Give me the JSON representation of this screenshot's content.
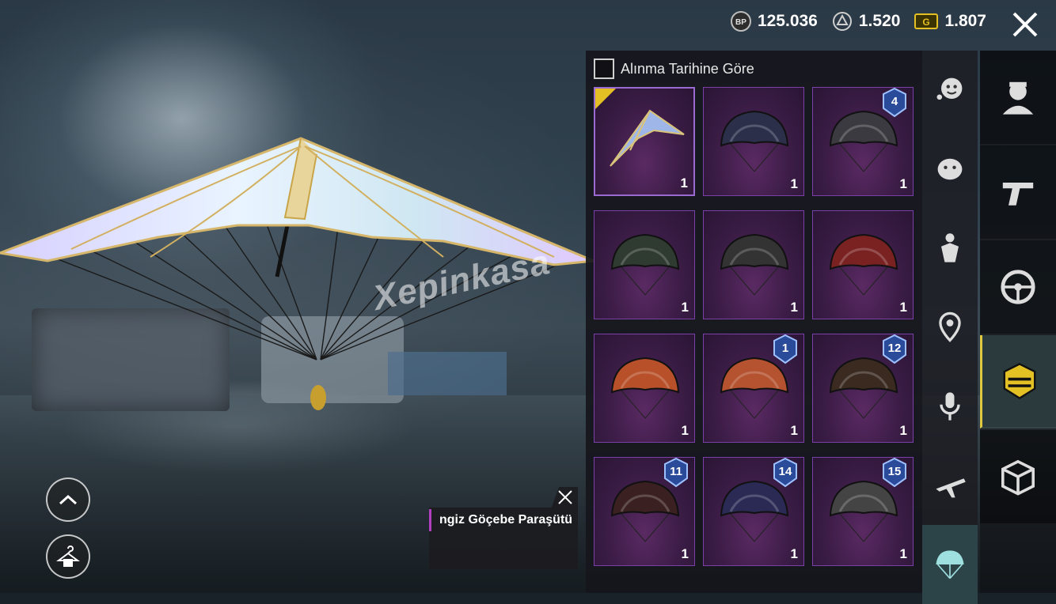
{
  "currency": {
    "bp": {
      "icon": "bp-coin-icon",
      "label": "BP",
      "value": "125.036"
    },
    "ag": {
      "icon": "ag-emblem-icon",
      "value": "1.520"
    },
    "uc": {
      "icon": "g-ticket-icon",
      "label": "G",
      "value": "1.807"
    }
  },
  "sort": {
    "label": "Alınma Tarihine Göre",
    "checked": false
  },
  "watermark": "Xepinkasa",
  "tooltip": {
    "name": "ngiz Göçebe Paraşütü"
  },
  "inventory": {
    "items": [
      {
        "icon": "glider-icon",
        "count": "1",
        "badge": "",
        "selected": true,
        "new": true
      },
      {
        "icon": "parachute-icon",
        "count": "1",
        "badge": ""
      },
      {
        "icon": "parachute-icon",
        "count": "1",
        "badge": "4"
      },
      {
        "icon": "parachute-icon",
        "count": "1",
        "badge": ""
      },
      {
        "icon": "parachute-icon",
        "count": "1",
        "badge": ""
      },
      {
        "icon": "parachute-icon",
        "count": "1",
        "badge": ""
      },
      {
        "icon": "parachute-icon",
        "count": "1",
        "badge": ""
      },
      {
        "icon": "parachute-icon",
        "count": "1",
        "badge": "1"
      },
      {
        "icon": "parachute-icon",
        "count": "1",
        "badge": "12"
      },
      {
        "icon": "parachute-icon",
        "count": "1",
        "badge": "11"
      },
      {
        "icon": "parachute-icon",
        "count": "1",
        "badge": "14"
      },
      {
        "icon": "parachute-icon",
        "count": "1",
        "badge": "15"
      }
    ]
  },
  "categories_sub": [
    {
      "icon": "emote-icon"
    },
    {
      "icon": "companion-icon"
    },
    {
      "icon": "pose-icon"
    },
    {
      "icon": "location-pin-icon"
    },
    {
      "icon": "microphone-icon"
    },
    {
      "icon": "airplane-icon"
    },
    {
      "icon": "parachute-icon",
      "active": true
    }
  ],
  "categories_main": [
    {
      "icon": "character-icon"
    },
    {
      "icon": "pistol-icon"
    },
    {
      "icon": "steering-wheel-icon"
    },
    {
      "icon": "season-shield-icon",
      "active": true
    },
    {
      "icon": "crate-icon"
    }
  ],
  "colors": {
    "tile_border": "#7b3fa8",
    "accent": "#e3c024",
    "active_tab": "#2c4447"
  }
}
